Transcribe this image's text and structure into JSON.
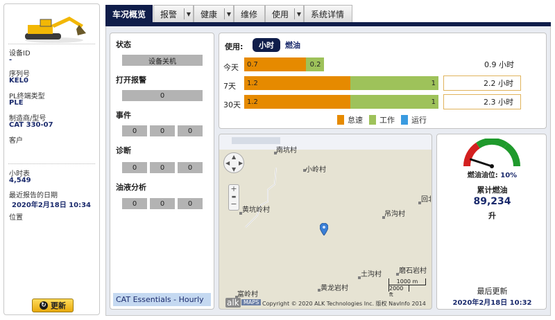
{
  "sidebar": {
    "device_id_label": "设备ID",
    "device_id_value": "-",
    "serial_label": "序列号",
    "serial_value": "KEL0",
    "pl_type_label": "PL终端类型",
    "pl_type_value": "PLE",
    "make_model_label": "制造商/型号",
    "make_model_value": "CAT 330-07",
    "customer_label": "客户",
    "hour_meter_label": "小时表",
    "hour_meter_value": "4,549",
    "last_report_label": "最近报告的日期",
    "last_report_value": "2020年2月18日 10:34",
    "location_label": "位置",
    "refresh_label": "更新"
  },
  "tabs": [
    {
      "label": "车况概览",
      "active": true,
      "dropdown": false
    },
    {
      "label": "报警",
      "active": false,
      "dropdown": true
    },
    {
      "label": "健康",
      "active": false,
      "dropdown": true
    },
    {
      "label": "维修",
      "active": false,
      "dropdown": false
    },
    {
      "label": "使用",
      "active": false,
      "dropdown": true
    },
    {
      "label": "系统详情",
      "active": false,
      "dropdown": false
    }
  ],
  "status": {
    "status_title": "状态",
    "status_value": "设备关机",
    "open_alarm_title": "打开报警",
    "open_alarm_value": "0",
    "events_title": "事件",
    "events_values": [
      "0",
      "0",
      "0"
    ],
    "diag_title": "诊断",
    "diag_values": [
      "0",
      "0",
      "0"
    ],
    "oil_title": "油液分析",
    "oil_values": [
      "0",
      "0",
      "0"
    ],
    "plan_label": "CAT Essentials - Hourly"
  },
  "usage": {
    "label": "使用:",
    "toggle_hours": "小时",
    "toggle_fuel": "燃油",
    "rows": [
      {
        "period": "今天",
        "idle": 0.7,
        "work": 0.2,
        "total": "0.9 小时",
        "boxed": false
      },
      {
        "period": "7天",
        "idle": 1.2,
        "work": 1.0,
        "total": "2.2 小时",
        "boxed": true
      },
      {
        "period": "30天",
        "idle": 1.2,
        "work": 1.0,
        "total": "2.3 小时",
        "boxed": true
      }
    ],
    "legend": [
      {
        "label": "怠速",
        "color": "#e68a00"
      },
      {
        "label": "工作",
        "color": "#9ec25a"
      },
      {
        "label": "运行",
        "color": "#3a9be0"
      }
    ]
  },
  "map": {
    "villages": [
      "南坑村",
      "小岭村",
      "黄坑岭村",
      "吊沟村",
      "回北",
      "土沟村",
      "磨石岩村",
      "黄龙岩村",
      "富岭村"
    ],
    "scale_m": "1000 m",
    "scale_ft": "2000 ft",
    "logo": "alk",
    "maps_tag": "MAPS",
    "copyright": "Copyright © 2020 ALK Technologies Inc. 版权 NavInfo 2014"
  },
  "fuel": {
    "level_label": "燃油油位:",
    "level_value": "10%",
    "level_fraction": 0.1,
    "cumulative_label": "累计燃油",
    "cumulative_value": "89,234",
    "unit": "升",
    "last_update_label": "最后更新",
    "last_update_value": "2020年2月18日 10:32"
  },
  "colors": {
    "brand_navy": "#0f1d4a",
    "idle_orange": "#e68a00",
    "work_green": "#9ec25a",
    "running_blue": "#3a9be0"
  }
}
